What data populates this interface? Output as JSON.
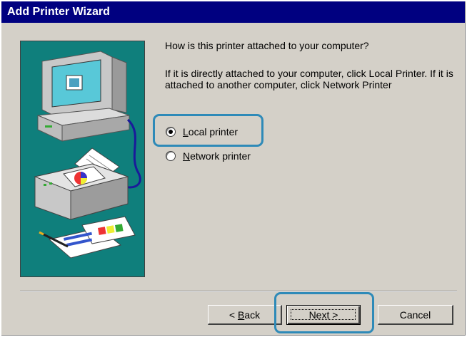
{
  "window": {
    "title": "Add Printer Wizard"
  },
  "content": {
    "question": "How is this printer attached to your computer?",
    "description": "If it is directly attached to your computer, click Local Printer. If it is attached to another computer, click Network Printer"
  },
  "options": [
    {
      "accel": "L",
      "rest": "ocal printer",
      "selected": true
    },
    {
      "accel": "N",
      "rest": "etwork printer",
      "selected": false
    }
  ],
  "buttons": {
    "back_prefix": "< ",
    "back_accel": "B",
    "back_rest": "ack",
    "next": "Next >",
    "cancel": "Cancel"
  },
  "colors": {
    "titlebar": "#000080",
    "illustration_bg": "#0f7f7c",
    "highlight": "#2e8ab8"
  }
}
